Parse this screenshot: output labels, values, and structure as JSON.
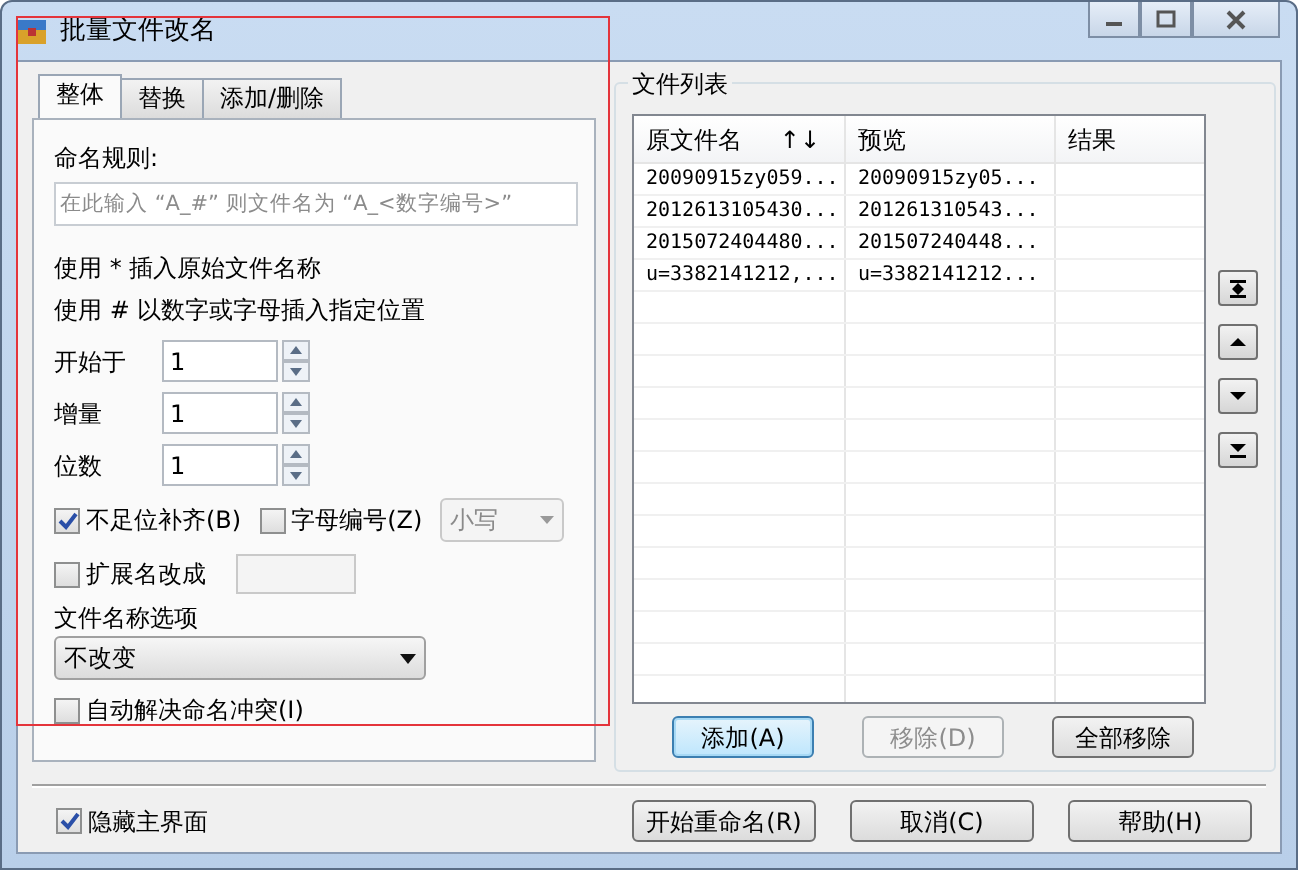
{
  "window": {
    "title": "批量文件改名"
  },
  "tabs": [
    {
      "label": "整体",
      "selected": true
    },
    {
      "label": "替换",
      "selected": false
    },
    {
      "label": "添加/删除",
      "selected": false
    }
  ],
  "rule": {
    "label": "命名规则:",
    "placeholder": "在此输入 “A_#” 则文件名为 “A_<数字编号>”"
  },
  "hints": [
    "使用 * 插入原始文件名称",
    "使用 # 以数字或字母插入指定位置"
  ],
  "spinners": [
    {
      "label": "开始于",
      "value": "1"
    },
    {
      "label": "增量",
      "value": "1"
    },
    {
      "label": "位数",
      "value": "1"
    }
  ],
  "pad_option": {
    "label": "不足位补齐(B)",
    "checked": true
  },
  "letter_option": {
    "label": "字母编号(Z)",
    "checked": false
  },
  "case_select": {
    "value": "小写",
    "disabled": true
  },
  "ext_option": {
    "label": "扩展名改成",
    "checked": false
  },
  "name_options": {
    "label": "文件名称选项",
    "value": "不改变"
  },
  "auto_resolve": {
    "label": "自动解决命名冲突(I)",
    "checked": false
  },
  "file_list": {
    "title": "文件列表",
    "columns": [
      "原文件名",
      "预览",
      "结果"
    ],
    "sort_indicator": "↑↓",
    "rows": [
      {
        "original": "20090915zy059...",
        "preview": "20090915zy05..."
      },
      {
        "original": "2012613105430...",
        "preview": "201261310543..."
      },
      {
        "original": "2015072404480...",
        "preview": "201507240448..."
      },
      {
        "original": "u=3382141212,...",
        "preview": "u=3382141212..."
      }
    ]
  },
  "list_buttons": [
    {
      "label": "添加(A)",
      "focused": true,
      "disabled": false
    },
    {
      "label": "移除(D)",
      "focused": false,
      "disabled": true
    },
    {
      "label": "全部移除",
      "focused": false,
      "disabled": false
    }
  ],
  "hide_main": {
    "label": "隐藏主界面",
    "checked": true
  },
  "dialog_buttons": [
    {
      "label": "开始重命名(R)"
    },
    {
      "label": "取消(C)"
    },
    {
      "label": "帮助(H)"
    }
  ]
}
